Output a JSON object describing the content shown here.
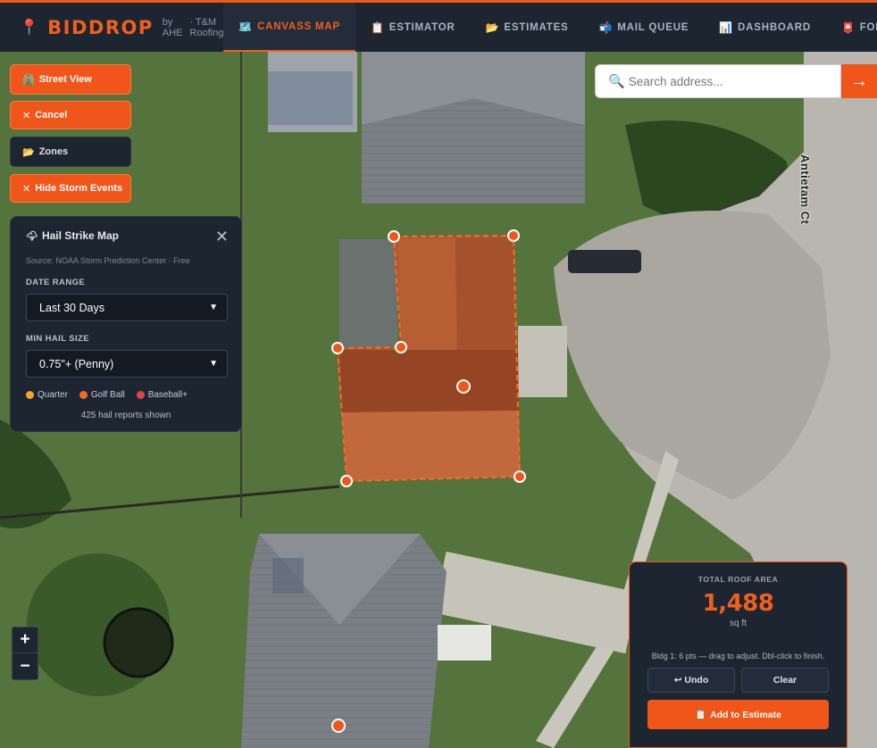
{
  "brand": {
    "name": "BIDDROP",
    "by": "by AHE",
    "company": "· T&M Roofing",
    "pin_icon": "📍"
  },
  "nav": {
    "tabs": [
      {
        "label": "CANVASS MAP",
        "icon": "🗺️",
        "active": true
      },
      {
        "label": "ESTIMATOR",
        "icon": "📋",
        "active": false
      },
      {
        "label": "ESTIMATES",
        "icon": "📂",
        "active": false
      },
      {
        "label": "MAIL QUEUE",
        "icon": "📬",
        "active": false
      },
      {
        "label": "DASHBOARD",
        "icon": "📊",
        "active": false
      },
      {
        "label": "FOLL",
        "icon": "📮",
        "active": false
      }
    ]
  },
  "map_buttons": {
    "street_view": {
      "label": "Street View",
      "icon": "🛣️"
    },
    "cancel": {
      "label": "Cancel",
      "icon": "✕"
    },
    "zones": {
      "label": "Zones",
      "icon": "📂"
    },
    "hide_storm": {
      "label": "Hide Storm Events",
      "icon": "✕"
    }
  },
  "search": {
    "placeholder": "Search address...",
    "icon": "🔍",
    "go": "→"
  },
  "hail_panel": {
    "title": "Hail Strike Map",
    "icon": "🌩",
    "source": "Source: NOAA Storm Prediction Center · Free",
    "date_range_label": "DATE RANGE",
    "date_range_value": "Last 30 Days",
    "min_size_label": "MIN HAIL SIZE",
    "min_size_value": "0.75\"+ (Penny)",
    "legend": [
      {
        "label": "Quarter",
        "color": "#f5a623"
      },
      {
        "label": "Golf Ball",
        "color": "#f36b21"
      },
      {
        "label": "Baseball+",
        "color": "#e8423c"
      }
    ],
    "count": "425 hail reports shown",
    "close": "✕"
  },
  "zoom": {
    "in": "+",
    "out": "−"
  },
  "street_name": "Antietam Ct",
  "area_panel": {
    "label": "TOTAL ROOF AREA",
    "value": "1,488",
    "unit": "sq ft",
    "hint": "Bldg 1: 6 pts — drag to adjust. Dbl-click to finish.",
    "undo": "↩ Undo",
    "clear": "Clear",
    "add": "Add to Estimate",
    "add_icon": "📋"
  },
  "colors": {
    "accent": "#f0561a",
    "panel": "#1d2531"
  }
}
